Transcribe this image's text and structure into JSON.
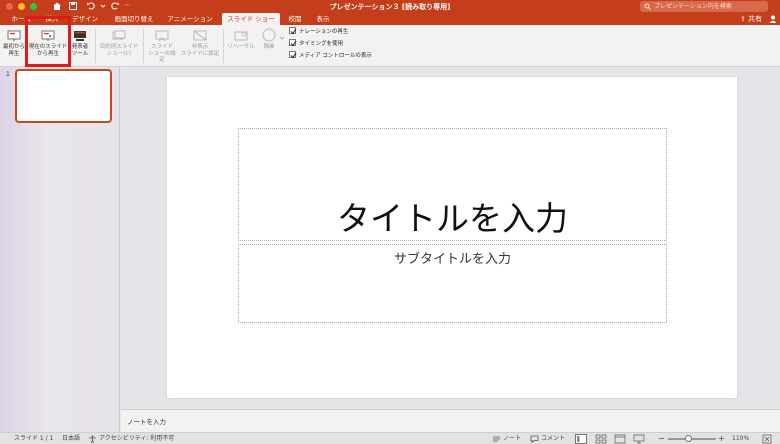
{
  "window": {
    "title": "プレゼンテーション３ [読み取り専用]",
    "search_placeholder": "プレゼンテーション内を検索"
  },
  "tabs": [
    {
      "label": "ホーム",
      "active": false
    },
    {
      "label": "挿入",
      "active": false
    },
    {
      "label": "デザイン",
      "active": false
    },
    {
      "label": "画面切り替え",
      "active": false
    },
    {
      "label": "アニメーション",
      "active": false
    },
    {
      "label": "スライド ショー",
      "active": true
    },
    {
      "label": "校閲",
      "active": false
    },
    {
      "label": "表示",
      "active": false
    }
  ],
  "share_label": "共有",
  "ribbon": {
    "from_beginning": {
      "line1": "最初から",
      "line2": "再生"
    },
    "from_current": {
      "line1": "現在のスライド",
      "line2": "から再生"
    },
    "presenter": {
      "line1": "発表者",
      "line2": "ツール"
    },
    "custom_show": {
      "line1": "目的別スライド",
      "line2": "ショー(C)"
    },
    "setup": {
      "line1": "スライド",
      "line2": "ショーの設定"
    },
    "hide": {
      "line1": "非表示",
      "line2": "スライドに設定"
    },
    "rehearse": {
      "line1": "リハーサル"
    },
    "record": {
      "line1": "録画"
    },
    "checkboxes": [
      {
        "label": "ナレーションの再生",
        "checked": true
      },
      {
        "label": "タイミングを使用",
        "checked": true
      },
      {
        "label": "メディア コントロールの表示",
        "checked": true
      }
    ]
  },
  "slides_panel": {
    "slide_number": "1"
  },
  "slide": {
    "title_placeholder": "タイトルを入力",
    "subtitle_placeholder": "サブタイトルを入力"
  },
  "notes_placeholder": "ノートを入力",
  "statusbar": {
    "slide_position": "スライド 1 / 1",
    "language": "日本語",
    "accessibility": "アクセシビリティ: 利用不可",
    "notes_label": "ノート",
    "comments_label": "コメント",
    "zoom": "110%"
  },
  "colors": {
    "accent": "#c43e1c",
    "highlight": "#e01a1a"
  }
}
